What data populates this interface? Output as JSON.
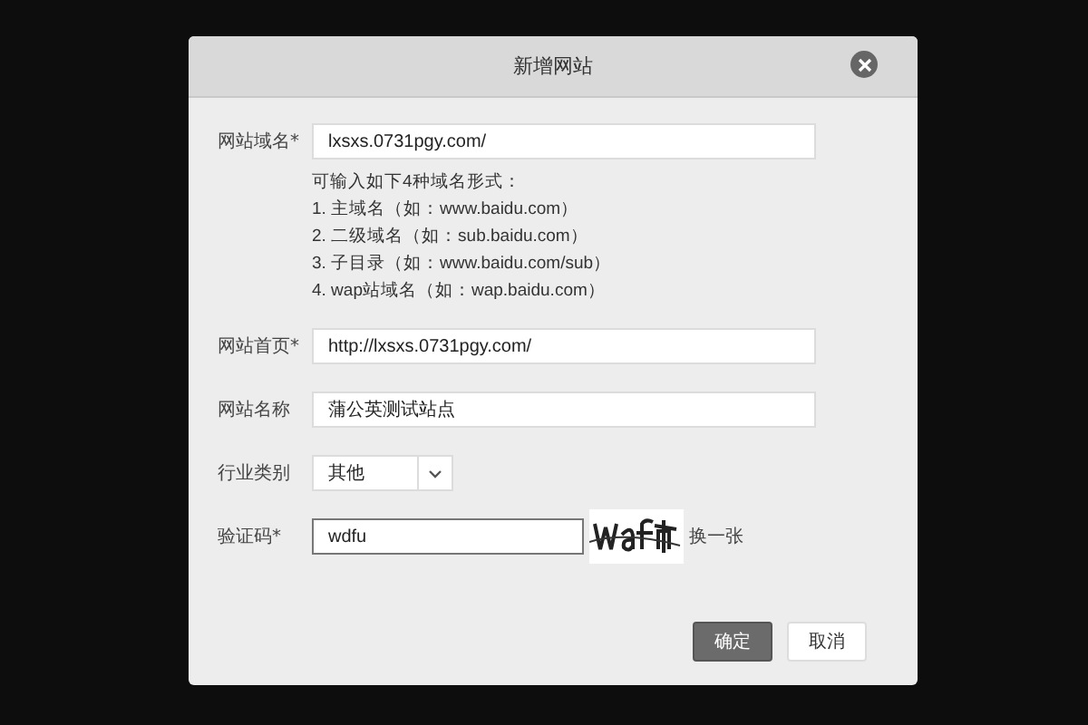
{
  "dialog": {
    "title": "新增网站"
  },
  "fields": [
    {
      "kind": "text",
      "label": "网站域名*",
      "value": "lxsxs.0731pgy.com/",
      "hint": [
        "可输入如下4种域名形式：",
        "1. 主域名（如：www.baidu.com）",
        "2. 二级域名（如：sub.baidu.com）",
        "3. 子目录（如：www.baidu.com/sub）",
        "4. wap站域名（如：wap.baidu.com）"
      ]
    },
    {
      "kind": "text",
      "label": "网站首页*",
      "value": "http://lxsxs.0731pgy.com/"
    },
    {
      "kind": "text",
      "label": "网站名称",
      "value": "蒲公英测试站点"
    },
    {
      "kind": "select",
      "label": "行业类别",
      "value": "其他"
    },
    {
      "kind": "captcha",
      "label": "验证码*",
      "value": "wdfu",
      "refresh": "换一张"
    }
  ],
  "buttons": [
    {
      "label": "确定",
      "primary": true
    },
    {
      "label": "取消",
      "primary": false
    }
  ]
}
